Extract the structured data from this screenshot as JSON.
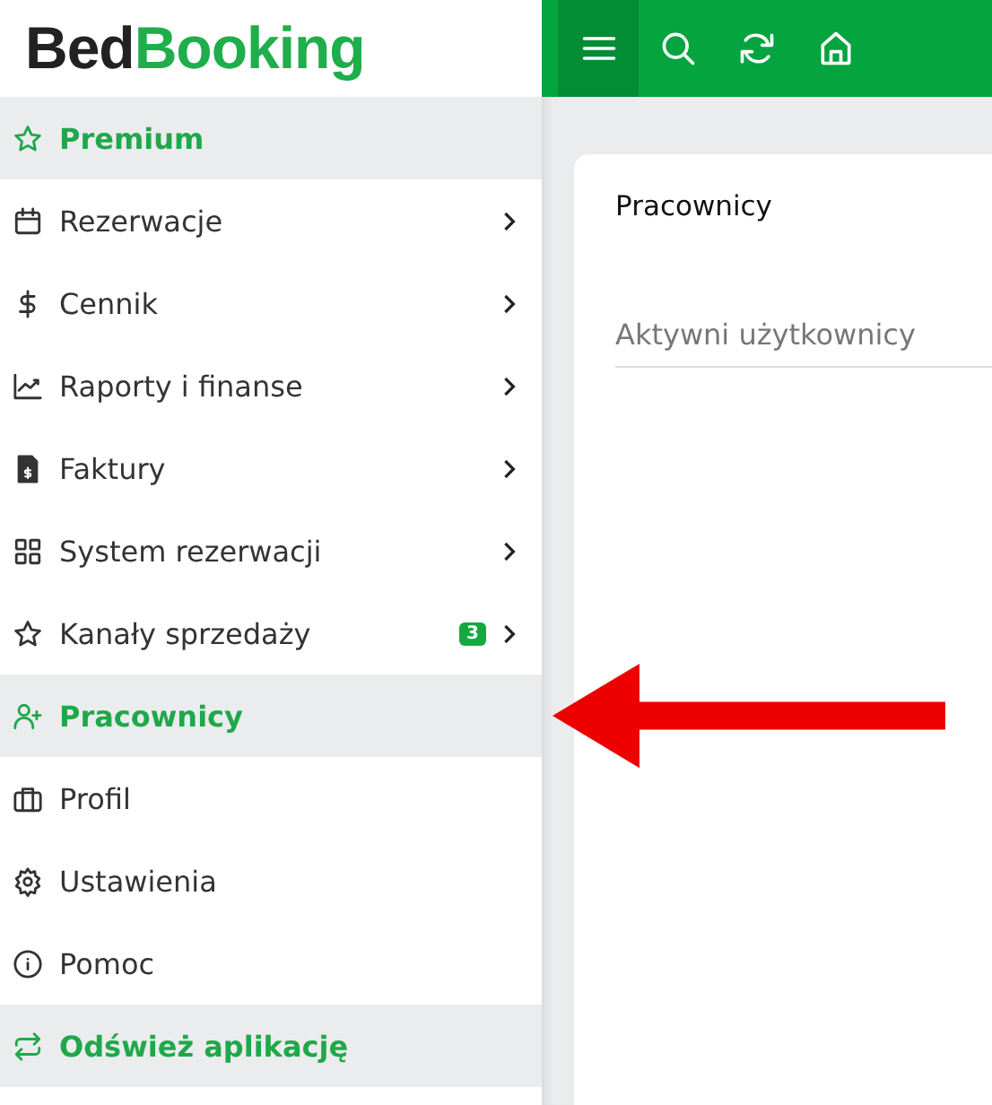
{
  "logo": {
    "part_1": "Bed",
    "part_2": "Booking"
  },
  "toolbar": [
    {
      "kind": "menu",
      "selected": true
    },
    {
      "kind": "search",
      "selected": false
    },
    {
      "kind": "refresh",
      "selected": false
    },
    {
      "kind": "home",
      "selected": false
    }
  ],
  "sidebar": {
    "items": [
      {
        "label": "Premium",
        "kind": "accent",
        "has_submenu": false
      },
      {
        "label": "Rezerwacje",
        "kind": "nav",
        "selected": false,
        "has_submenu": true
      },
      {
        "label": "Cennik",
        "kind": "nav",
        "selected": false,
        "has_submenu": true
      },
      {
        "label": "Raporty i finanse",
        "kind": "nav",
        "selected": false,
        "has_submenu": true
      },
      {
        "label": "Faktury",
        "kind": "nav",
        "selected": false,
        "has_submenu": true
      },
      {
        "label": "System rezerwacji",
        "kind": "nav",
        "selected": false,
        "has_submenu": true
      },
      {
        "label": "Kanały sprzedaży",
        "kind": "nav",
        "selected": false,
        "has_submenu": true,
        "badge": "3"
      },
      {
        "label": "Pracownicy",
        "kind": "nav",
        "selected": true,
        "has_submenu": false
      },
      {
        "label": "Profil",
        "kind": "nav",
        "selected": false,
        "has_submenu": false
      },
      {
        "label": "Ustawienia",
        "kind": "nav",
        "selected": false,
        "has_submenu": false
      },
      {
        "label": "Pomoc",
        "kind": "nav",
        "selected": false,
        "has_submenu": false
      },
      {
        "label": "Odśwież aplikację",
        "kind": "accent",
        "has_submenu": false
      }
    ]
  },
  "card": {
    "title": "Pracownicy",
    "tabs": [
      {
        "label": "Aktywni użytkownicy",
        "selected": true
      }
    ]
  }
}
